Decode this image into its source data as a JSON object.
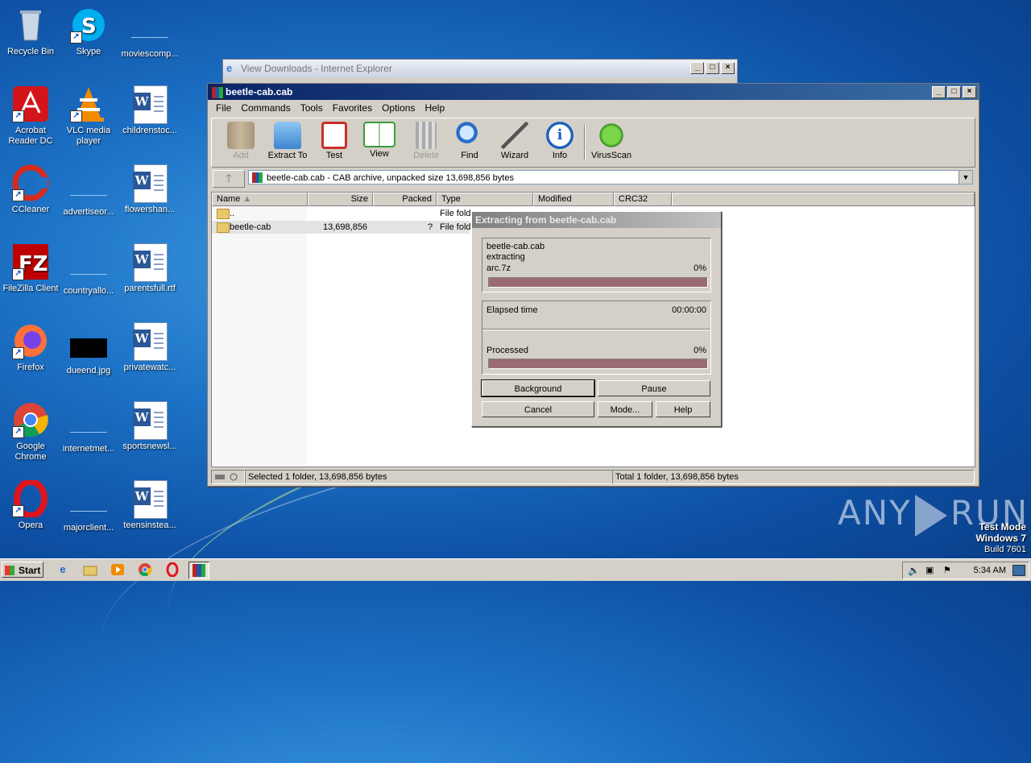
{
  "desktop": {
    "icons": [
      {
        "label": "Recycle Bin"
      },
      {
        "label": "Skype"
      },
      {
        "label": "moviescomp..."
      },
      {
        "label": "Acrobat Reader DC"
      },
      {
        "label": "VLC media player"
      },
      {
        "label": "childrenstoc..."
      },
      {
        "label": "CCleaner"
      },
      {
        "label": "advertiseor..."
      },
      {
        "label": "flowershan..."
      },
      {
        "label": "FileZilla Client"
      },
      {
        "label": "countryallo..."
      },
      {
        "label": "parentsfull.rtf"
      },
      {
        "label": "Firefox"
      },
      {
        "label": "dueend.jpg"
      },
      {
        "label": "privatewatc..."
      },
      {
        "label": "Google Chrome"
      },
      {
        "label": "internetmet..."
      },
      {
        "label": "sportsnewsl..."
      },
      {
        "label": "Opera"
      },
      {
        "label": "majorclient..."
      },
      {
        "label": "teensinstea..."
      }
    ]
  },
  "ie_window": {
    "title": "View Downloads - Internet Explorer"
  },
  "winrar": {
    "title": "beetle-cab.cab",
    "menu": [
      "File",
      "Commands",
      "Tools",
      "Favorites",
      "Options",
      "Help"
    ],
    "toolbar": [
      {
        "label": "Add",
        "icon": "add-icon",
        "disabled": true
      },
      {
        "label": "Extract To",
        "icon": "extract-icon"
      },
      {
        "label": "Test",
        "icon": "test-icon"
      },
      {
        "label": "View",
        "icon": "view-icon"
      },
      {
        "label": "Delete",
        "icon": "delete-icon",
        "disabled": true
      },
      {
        "label": "Find",
        "icon": "find-icon"
      },
      {
        "label": "Wizard",
        "icon": "wizard-icon"
      },
      {
        "label": "Info",
        "icon": "info-icon"
      },
      {
        "label": "VirusScan",
        "icon": "virusscan-icon"
      }
    ],
    "address": "beetle-cab.cab - CAB archive, unpacked size 13,698,856 bytes",
    "columns": [
      "Name",
      "Size",
      "Packed",
      "Type",
      "Modified",
      "CRC32"
    ],
    "rows": [
      {
        "name": "..",
        "size": "",
        "packed": "",
        "type": "File fold"
      },
      {
        "name": "beetle-cab",
        "size": "13,698,856",
        "packed": "?",
        "type": "File fold"
      }
    ],
    "status_left": "Selected 1 folder, 13,698,856 bytes",
    "status_right": "Total 1 folder, 13,698,856 bytes"
  },
  "dialog": {
    "title": "Extracting from beetle-cab.cab",
    "archive": "beetle-cab.cab",
    "action": "extracting",
    "file": "arc.7z",
    "file_percent": "0%",
    "file_progress": 0,
    "elapsed_label": "Elapsed time",
    "elapsed_value": "00:00:00",
    "processed_label": "Processed",
    "processed_percent": "0%",
    "processed_progress": 0,
    "buttons": {
      "background": "Background",
      "pause": "Pause",
      "cancel": "Cancel",
      "mode": "Mode...",
      "help": "Help"
    }
  },
  "watermark": {
    "brand_left": "ANY",
    "brand_right": "RUN"
  },
  "testmode": {
    "line1": "Test Mode",
    "line2": "Windows 7",
    "line3": "Build 7601"
  },
  "taskbar": {
    "start": "Start",
    "clock": "5:34 AM"
  }
}
